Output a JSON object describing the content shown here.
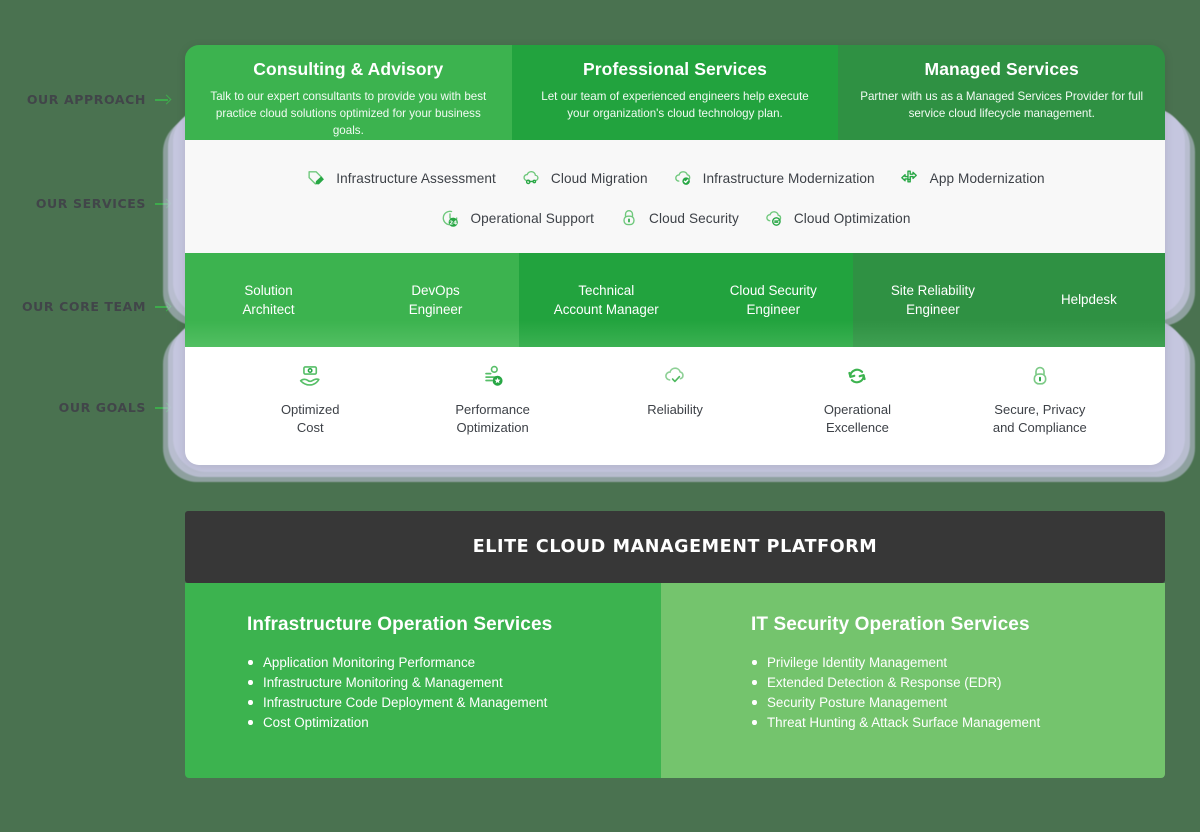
{
  "colors": {
    "background": "#4a7250",
    "green_light": "#3cb34f",
    "green_mid": "#22a33e",
    "green_dark": "#2f9143",
    "green_pale": "#74c46d",
    "dark_bar": "#373737",
    "lavender": "#c6c7e0",
    "text_dark": "#3d4147",
    "icon_green": "#3eab4c"
  },
  "rail": [
    {
      "label": "OUR APPROACH",
      "icon": "arrow-right-icon"
    },
    {
      "label": "OUR SERVICES",
      "icon": "arrow-right-icon"
    },
    {
      "label": "OUR CORE TEAM",
      "icon": "arrow-right-icon"
    },
    {
      "label": "OUR GOALS",
      "icon": "arrow-right-icon"
    }
  ],
  "approach": [
    {
      "title": "Consulting & Advisory",
      "description": "Talk to our expert consultants to provide you with best practice cloud solutions optimized for your business goals.",
      "color": "#3cb34f"
    },
    {
      "title": "Professional Services",
      "description": "Let our team of experienced engineers help execute your organization's cloud technology plan.",
      "color": "#22a33e"
    },
    {
      "title": "Managed Services",
      "description": "Partner with us as a Managed Services Provider for full service cloud lifecycle management.",
      "color": "#2f9143"
    }
  ],
  "services": {
    "row1": [
      {
        "label": "Infrastructure Assessment",
        "icon": "tag-pencil-icon"
      },
      {
        "label": "Cloud Migration",
        "icon": "cloud-migration-icon"
      },
      {
        "label": "Infrastructure Modernization",
        "icon": "cloud-check-icon"
      },
      {
        "label": "App Modernization",
        "icon": "app-modernization-icon"
      }
    ],
    "row2": [
      {
        "label": "Operational Support",
        "icon": "clock-24-icon"
      },
      {
        "label": "Cloud Security",
        "icon": "lock-icon"
      },
      {
        "label": "Cloud Optimization",
        "icon": "cloud-optimization-icon"
      }
    ]
  },
  "core_team": [
    {
      "label": "Solution\nArchitect",
      "color": "#3cb34f"
    },
    {
      "label": "DevOps\nEngineer",
      "color": "#3cb34f"
    },
    {
      "label": "Technical\nAccount Manager",
      "color": "#22a33e"
    },
    {
      "label": "Cloud Security\nEngineer",
      "color": "#22a33e"
    },
    {
      "label": "Site Reliability\nEngineer",
      "color": "#2f9143"
    },
    {
      "label": "Helpdesk",
      "color": "#2f9143"
    }
  ],
  "goals": [
    {
      "label": "Optimized\nCost",
      "icon": "money-hand-icon"
    },
    {
      "label": "Performance\nOptimization",
      "icon": "user-star-icon"
    },
    {
      "label": "Reliability",
      "icon": "cloud-check-outline-icon"
    },
    {
      "label": "Operational\nExcellence",
      "icon": "refresh-cycle-icon"
    },
    {
      "label": "Secure, Privacy\nand Compliance",
      "icon": "lock-shield-icon"
    }
  ],
  "platform": {
    "title": "ELITE CLOUD MANAGEMENT PLATFORM"
  },
  "bottom_panels": [
    {
      "title": "Infrastructure Operation Services",
      "items": [
        "Application Monitoring Performance",
        "Infrastructure Monitoring & Management",
        "Infrastructure Code Deployment & Management",
        "Cost Optimization"
      ]
    },
    {
      "title": "IT Security Operation Services",
      "items": [
        "Privilege Identity Management",
        "Extended Detection & Response (EDR)",
        "Security Posture Management",
        "Threat Hunting & Attack Surface Management"
      ]
    }
  ]
}
